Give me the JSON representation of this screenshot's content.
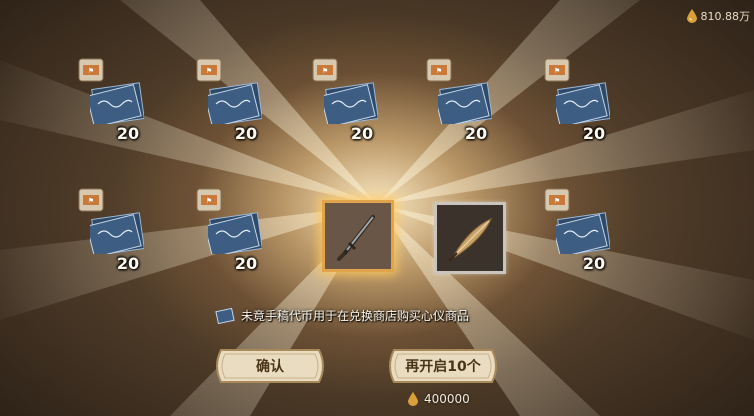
{
  "currency": {
    "balance": "810.88万",
    "icon": "ink-drop-icon"
  },
  "rewards": [
    {
      "name": "manuscript-ticket",
      "qty": "20"
    },
    {
      "name": "manuscript-ticket",
      "qty": "20"
    },
    {
      "name": "manuscript-ticket",
      "qty": "20"
    },
    {
      "name": "manuscript-ticket",
      "qty": "20"
    },
    {
      "name": "manuscript-ticket",
      "qty": "20"
    },
    {
      "name": "manuscript-ticket",
      "qty": "20"
    },
    {
      "name": "manuscript-ticket",
      "qty": "20"
    },
    {
      "name": "manuscript-ticket",
      "qty": "20"
    }
  ],
  "special_items": [
    {
      "name": "sword-accessory",
      "rarity_color": "#e0a54a"
    },
    {
      "name": "feather-quill",
      "rarity_color": "#c9c4be"
    }
  ],
  "info_text": "未竟手稿代币用于在兑换商店购买心仪商品",
  "buttons": {
    "confirm": "确认",
    "again": "再开启10个"
  },
  "cost": "400000",
  "colors": {
    "gold_glow": "#e0a54a",
    "button_face": "#eadcc0",
    "text_light": "#fbf6ea"
  }
}
